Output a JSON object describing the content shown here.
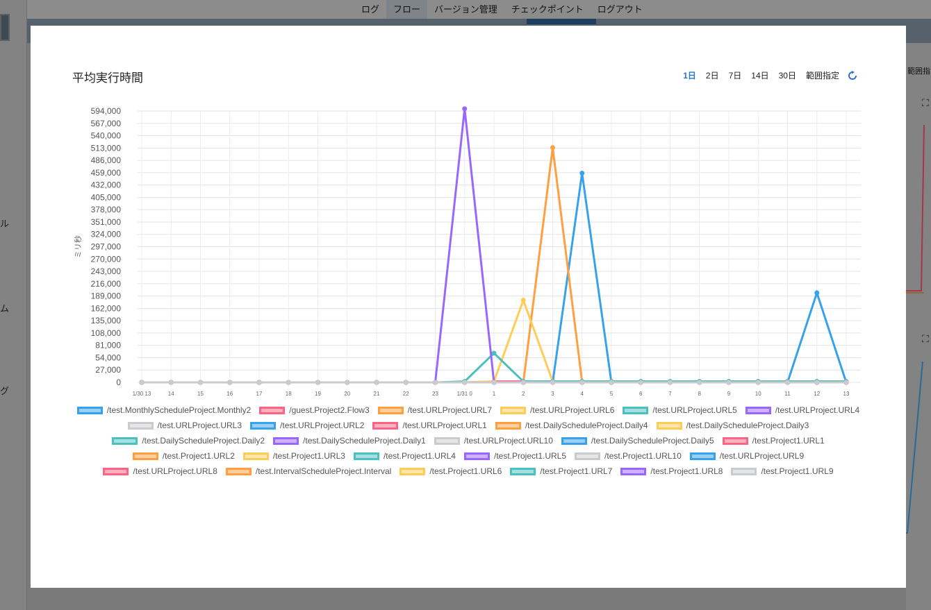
{
  "nav": {
    "items": [
      "ログ",
      "フロー",
      "バージョン管理",
      "チェックポイント",
      "ログアウト"
    ],
    "active_index": 1
  },
  "sidebar": {
    "label_1": "ル",
    "label_2": "ム",
    "label_3": "グ"
  },
  "right_panel": {
    "range_label": "範囲指"
  },
  "modal": {
    "title": "平均実行時間",
    "range_buttons": [
      "1日",
      "2日",
      "7日",
      "14日",
      "30日",
      "範囲指定"
    ],
    "active_range_index": 0,
    "refresh_icon": "refresh-icon"
  },
  "colors": {
    "blue": "#36a2eb",
    "red": "#ff6384",
    "orange": "#ff9f40",
    "yellow": "#ffcd56",
    "teal": "#4bc0c0",
    "purple": "#9966ff",
    "grey": "#c9cbcf"
  },
  "chart_data": {
    "type": "line",
    "ylabel": "ミリ秒",
    "xlabel": "",
    "ylim": [
      0,
      594000
    ],
    "yticks": [
      "594,000",
      "567,000",
      "540,000",
      "513,000",
      "486,000",
      "459,000",
      "432,000",
      "405,000",
      "378,000",
      "351,000",
      "324,000",
      "297,000",
      "270,000",
      "243,000",
      "216,000",
      "189,000",
      "162,000",
      "135,000",
      "108,000",
      "81,000",
      "54,000",
      "27,000",
      "0"
    ],
    "categories": [
      "1/30 13",
      "14",
      "15",
      "16",
      "17",
      "18",
      "19",
      "20",
      "21",
      "22",
      "23",
      "1/31 0",
      "1",
      "2",
      "3",
      "4",
      "5",
      "6",
      "7",
      "8",
      "9",
      "10",
      "11",
      "12",
      "13"
    ],
    "grid": true,
    "legend_position": "bottom",
    "series": [
      {
        "name": "/test.MonthlyScheduleProject.Monthly2",
        "color": "#36a2eb",
        "values": [
          0,
          0,
          0,
          0,
          0,
          0,
          0,
          0,
          0,
          0,
          0,
          0,
          0,
          0,
          0,
          0,
          0,
          0,
          0,
          0,
          0,
          0,
          0,
          0,
          0
        ]
      },
      {
        "name": "/guest.Project2.Flow3",
        "color": "#ff6384",
        "values": [
          0,
          0,
          0,
          0,
          0,
          0,
          0,
          0,
          0,
          0,
          0,
          0,
          0,
          0,
          0,
          0,
          0,
          0,
          0,
          0,
          0,
          0,
          0,
          0,
          0
        ]
      },
      {
        "name": "/test.URLProject.URL7",
        "color": "#ff9f40",
        "values": [
          0,
          0,
          0,
          0,
          0,
          0,
          0,
          0,
          0,
          0,
          0,
          0,
          0,
          0,
          0,
          0,
          0,
          0,
          0,
          0,
          0,
          0,
          0,
          0,
          0
        ]
      },
      {
        "name": "/test.URLProject.URL6",
        "color": "#ffcd56",
        "values": [
          0,
          0,
          0,
          0,
          0,
          0,
          0,
          0,
          0,
          0,
          0,
          0,
          0,
          0,
          0,
          0,
          0,
          0,
          0,
          0,
          0,
          0,
          0,
          0,
          0
        ]
      },
      {
        "name": "/test.URLProject.URL5",
        "color": "#4bc0c0",
        "values": [
          0,
          0,
          0,
          0,
          0,
          0,
          0,
          0,
          0,
          0,
          0,
          0,
          0,
          0,
          0,
          0,
          0,
          0,
          0,
          0,
          0,
          0,
          0,
          0,
          0
        ]
      },
      {
        "name": "/test.URLProject.URL4",
        "color": "#9966ff",
        "values": [
          0,
          0,
          0,
          0,
          0,
          0,
          0,
          0,
          0,
          0,
          0,
          0,
          0,
          0,
          0,
          0,
          0,
          0,
          0,
          0,
          0,
          0,
          0,
          0,
          0
        ]
      },
      {
        "name": "/test.URLProject.URL3",
        "color": "#c9cbcf",
        "values": [
          0,
          0,
          0,
          0,
          0,
          0,
          0,
          0,
          0,
          0,
          0,
          0,
          0,
          0,
          0,
          0,
          0,
          0,
          0,
          0,
          0,
          0,
          0,
          0,
          0
        ]
      },
      {
        "name": "/test.URLProject.URL2",
        "color": "#36a2eb",
        "values": [
          0,
          0,
          0,
          0,
          0,
          0,
          0,
          0,
          0,
          0,
          0,
          0,
          0,
          0,
          0,
          0,
          0,
          0,
          0,
          0,
          0,
          0,
          0,
          0,
          0
        ]
      },
      {
        "name": "/test.URLProject.URL1",
        "color": "#ff6384",
        "values": [
          0,
          0,
          0,
          0,
          0,
          0,
          0,
          0,
          0,
          0,
          0,
          0,
          0,
          0,
          0,
          0,
          0,
          0,
          0,
          0,
          0,
          0,
          0,
          0,
          0
        ]
      },
      {
        "name": "/test.DailyScheduleProject.Daily4",
        "color": "#ff9f40",
        "values": [
          0,
          0,
          0,
          0,
          0,
          0,
          0,
          0,
          0,
          0,
          0,
          0,
          0,
          0,
          0,
          0,
          0,
          0,
          0,
          0,
          0,
          0,
          0,
          0,
          0
        ]
      },
      {
        "name": "/test.DailyScheduleProject.Daily3",
        "color": "#ffcd56",
        "values": [
          0,
          0,
          0,
          0,
          0,
          0,
          0,
          0,
          0,
          0,
          0,
          0,
          0,
          0,
          0,
          0,
          0,
          0,
          0,
          0,
          0,
          0,
          0,
          0,
          0
        ]
      },
      {
        "name": "/test.DailyScheduleProject.Daily2",
        "color": "#4bc0c0",
        "values": [
          0,
          0,
          0,
          0,
          0,
          0,
          0,
          0,
          0,
          0,
          0,
          0,
          0,
          0,
          0,
          0,
          0,
          0,
          0,
          0,
          0,
          0,
          0,
          0,
          0
        ]
      },
      {
        "name": "/test.DailyScheduleProject.Daily1",
        "color": "#9966ff",
        "values": [
          0,
          0,
          0,
          0,
          0,
          0,
          0,
          0,
          0,
          0,
          0,
          0,
          0,
          0,
          0,
          0,
          0,
          0,
          0,
          0,
          0,
          0,
          0,
          0,
          0
        ]
      },
      {
        "name": "/test.URLProject.URL10",
        "color": "#c9cbcf",
        "values": [
          0,
          0,
          0,
          0,
          0,
          0,
          0,
          0,
          0,
          0,
          0,
          0,
          0,
          0,
          0,
          0,
          0,
          0,
          0,
          0,
          0,
          0,
          0,
          0,
          0
        ]
      },
      {
        "name": "/test.DailyScheduleProject.Daily5",
        "color": "#36a2eb",
        "values": [
          0,
          0,
          0,
          0,
          0,
          0,
          0,
          0,
          0,
          0,
          0,
          0,
          0,
          0,
          0,
          458000,
          0,
          0,
          0,
          0,
          0,
          0,
          0,
          196000,
          0
        ]
      },
      {
        "name": "/test.Project1.URL1",
        "color": "#ff6384",
        "values": [
          0,
          0,
          0,
          0,
          0,
          0,
          0,
          0,
          0,
          0,
          0,
          0,
          2000,
          2000,
          2000,
          2000,
          2000,
          2000,
          2000,
          2000,
          2000,
          2000,
          2000,
          2000,
          2000
        ]
      },
      {
        "name": "/test.Project1.URL2",
        "color": "#ff9f40",
        "values": [
          0,
          0,
          0,
          0,
          0,
          0,
          0,
          0,
          0,
          0,
          0,
          0,
          0,
          0,
          514000,
          2000,
          2000,
          2000,
          2000,
          2000,
          2000,
          2000,
          2000,
          2000,
          2000
        ]
      },
      {
        "name": "/test.Project1.URL3",
        "color": "#ffcd56",
        "values": [
          0,
          0,
          0,
          0,
          0,
          0,
          0,
          0,
          0,
          0,
          0,
          0,
          2000,
          180000,
          2000,
          2000,
          2000,
          2000,
          2000,
          2000,
          2000,
          2000,
          2000,
          2000,
          2000
        ]
      },
      {
        "name": "/test.Project1.URL4",
        "color": "#4bc0c0",
        "values": [
          0,
          0,
          0,
          0,
          0,
          0,
          0,
          0,
          0,
          0,
          0,
          2000,
          64000,
          2000,
          2000,
          2000,
          2000,
          2000,
          2000,
          2000,
          2000,
          2000,
          2000,
          2000,
          2000
        ]
      },
      {
        "name": "/test.Project1.URL5",
        "color": "#9966ff",
        "values": [
          0,
          0,
          0,
          0,
          0,
          0,
          0,
          0,
          0,
          0,
          0,
          599000,
          0,
          0,
          0,
          0,
          0,
          0,
          0,
          0,
          0,
          0,
          0,
          0,
          0
        ]
      },
      {
        "name": "/test.Project1.URL10",
        "color": "#c9cbcf",
        "values": [
          0,
          0,
          0,
          0,
          0,
          0,
          0,
          0,
          0,
          0,
          0,
          0,
          0,
          0,
          0,
          0,
          0,
          0,
          0,
          0,
          0,
          0,
          0,
          0,
          0
        ]
      },
      {
        "name": "/test.URLProject.URL9",
        "color": "#36a2eb",
        "values": [
          0,
          0,
          0,
          0,
          0,
          0,
          0,
          0,
          0,
          0,
          0,
          0,
          0,
          0,
          0,
          0,
          0,
          0,
          0,
          0,
          0,
          0,
          0,
          0,
          0
        ]
      },
      {
        "name": "/test.URLProject.URL8",
        "color": "#ff6384",
        "values": [
          0,
          0,
          0,
          0,
          0,
          0,
          0,
          0,
          0,
          0,
          0,
          0,
          0,
          0,
          0,
          0,
          0,
          0,
          0,
          0,
          0,
          0,
          0,
          0,
          0
        ]
      },
      {
        "name": "/test.IntervalScheduleProject.Interval",
        "color": "#ff9f40",
        "values": [
          0,
          0,
          0,
          0,
          0,
          0,
          0,
          0,
          0,
          0,
          0,
          0,
          0,
          0,
          0,
          0,
          0,
          0,
          0,
          0,
          0,
          0,
          0,
          0,
          0
        ]
      },
      {
        "name": "/test.Project1.URL6",
        "color": "#ffcd56",
        "values": [
          0,
          0,
          0,
          0,
          0,
          0,
          0,
          0,
          0,
          0,
          0,
          0,
          0,
          0,
          0,
          0,
          0,
          0,
          0,
          0,
          0,
          0,
          0,
          0,
          0
        ]
      },
      {
        "name": "/test.Project1.URL7",
        "color": "#4bc0c0",
        "values": [
          0,
          0,
          0,
          0,
          0,
          0,
          0,
          0,
          0,
          0,
          0,
          0,
          0,
          0,
          0,
          0,
          0,
          0,
          0,
          0,
          0,
          0,
          0,
          0,
          0
        ]
      },
      {
        "name": "/test.Project1.URL8",
        "color": "#9966ff",
        "values": [
          0,
          0,
          0,
          0,
          0,
          0,
          0,
          0,
          0,
          0,
          0,
          0,
          0,
          0,
          0,
          0,
          0,
          0,
          0,
          0,
          0,
          0,
          0,
          0,
          0
        ]
      },
      {
        "name": "/test.Project1.URL9",
        "color": "#c9cbcf",
        "values": [
          0,
          0,
          0,
          0,
          0,
          0,
          0,
          0,
          0,
          0,
          0,
          0,
          0,
          0,
          0,
          0,
          0,
          0,
          0,
          0,
          0,
          0,
          0,
          0,
          0
        ]
      }
    ]
  }
}
